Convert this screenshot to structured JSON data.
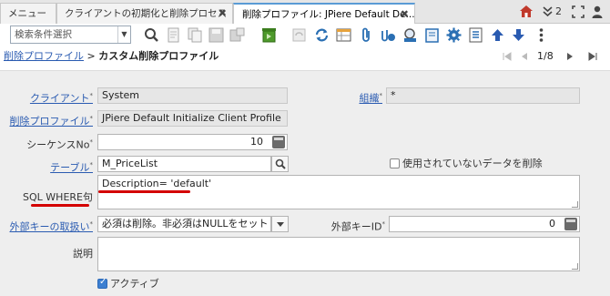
{
  "tabs": [
    {
      "label": "メニュー"
    },
    {
      "label": "クライアントの初期化と削除プロセス",
      "close": "✖"
    },
    {
      "label": "削除プロファイル: JPiere Default De...",
      "close": "✖"
    }
  ],
  "topright": {
    "count": "2"
  },
  "toolbar": {
    "search_placeholder": "検索条件選択"
  },
  "breadcrumb": {
    "parent": "削除プロファイル",
    "separator": ">",
    "current": "カスタム削除プロファイル"
  },
  "pager": {
    "text": "1/8"
  },
  "form": {
    "client": {
      "label": "クライアント",
      "value": "System"
    },
    "org": {
      "label": "組織",
      "value": "*"
    },
    "profile": {
      "label": "削除プロファイル",
      "value": "JPiere Default Initialize Client Profile"
    },
    "sequence": {
      "label": "シーケンスNo",
      "value": "10"
    },
    "table": {
      "label": "テーブル",
      "value": "M_PriceList"
    },
    "unused": {
      "label": "使用されていないデータを削除"
    },
    "sqlwhere": {
      "label": "SQL WHERE句",
      "value": "Description= 'default'"
    },
    "fk": {
      "label": "外部キーの取扱い",
      "value": "必須は削除。非必須はNULLをセット"
    },
    "fkid": {
      "label": "外部キーID",
      "value": "0"
    },
    "desc": {
      "label": "説明",
      "value": ""
    },
    "active": {
      "label": "アクティブ"
    }
  },
  "colors": {
    "accent": "#3c7fd1",
    "highlight": "#d40000",
    "link": "#2a5bb1"
  }
}
